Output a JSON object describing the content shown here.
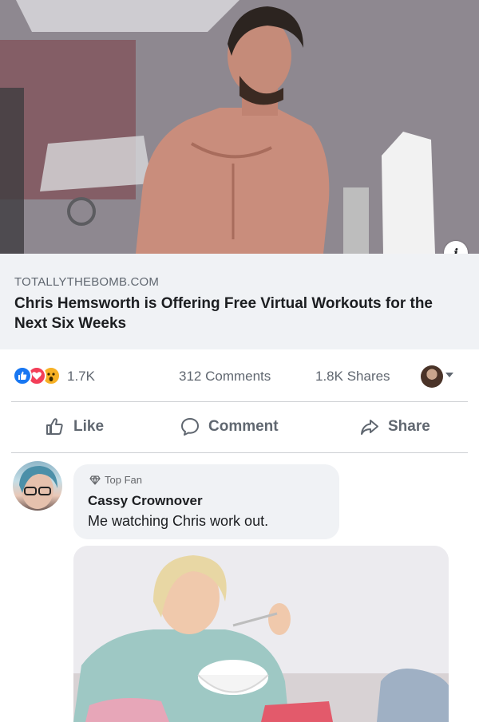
{
  "post": {
    "image": {
      "icon": "shirtless-man-photo"
    },
    "info_icon_glyph": "i",
    "link": {
      "domain": "TOTALLYTHEBOMB.COM",
      "title": "Chris Hemsworth is Offering Free Virtual Workouts for the Next Six Weeks"
    },
    "stats": {
      "reaction_icons": [
        "like-reaction-icon",
        "love-reaction-icon",
        "wow-reaction-icon"
      ],
      "reaction_count": "1.7K",
      "comments": "312 Comments",
      "shares": "1.8K Shares"
    },
    "actions": {
      "like": "Like",
      "comment": "Comment",
      "share": "Share"
    }
  },
  "comment": {
    "badge": "Top Fan",
    "author": "Cassy Crownover",
    "text": "Me watching Chris work out.",
    "attachment": {
      "icon": "woman-eating-cereal-photo"
    }
  },
  "colors": {
    "like_blue": "#1877f2",
    "love_red": "#f33e58",
    "wow_yellow": "#f7b125",
    "link_bg": "#f0f2f5",
    "secondary_text": "#606770"
  }
}
